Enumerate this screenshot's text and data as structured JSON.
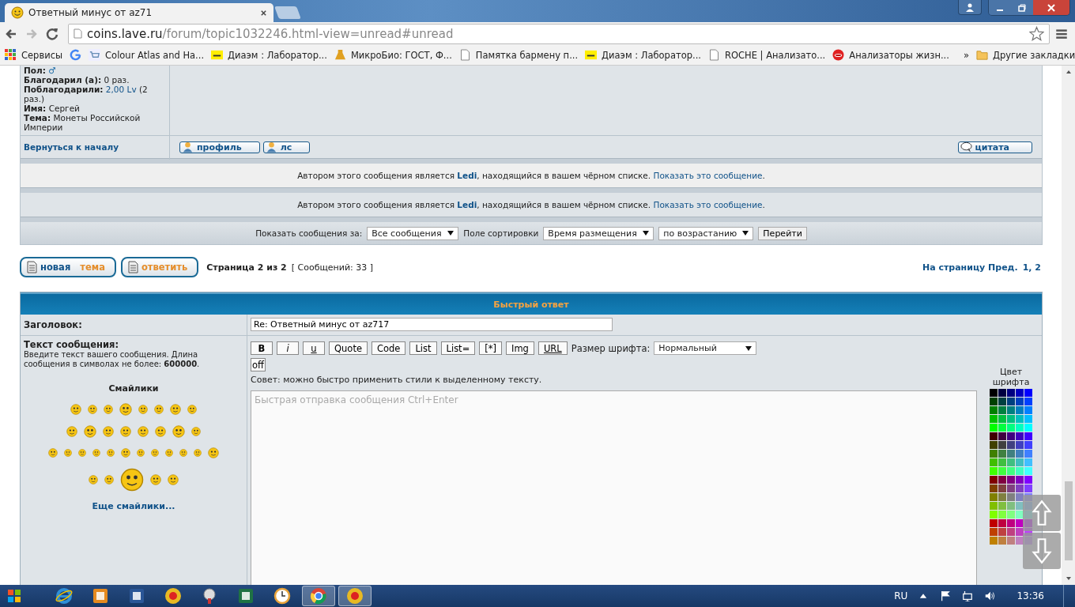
{
  "browser": {
    "tab_title": "Ответный минус от az71",
    "url_host": "coins.lave.ru",
    "url_path": "/forum/topic1032246.html-view=unread#unread",
    "bookmarks": [
      {
        "kind": "apps",
        "label": "Сервисы"
      },
      {
        "kind": "google"
      },
      {
        "kind": "cart",
        "label": "Colour Atlas and Ha..."
      },
      {
        "kind": "yellow",
        "label": "Диаэм : Лаборатор..."
      },
      {
        "kind": "micro",
        "label": "МикроБио: ГОСТ, Ф..."
      },
      {
        "kind": "page",
        "label": "Памятка бармену п..."
      },
      {
        "kind": "yellow",
        "label": "Диаэм : Лаборатор..."
      },
      {
        "kind": "page",
        "label": "ROCHE | Анализато..."
      },
      {
        "kind": "lips",
        "label": "Анализаторы жизн..."
      }
    ],
    "overflow": "»",
    "other_bookmarks": "Другие закладки"
  },
  "profile": {
    "fields": [
      {
        "label": "Пол:",
        "value": "♂",
        "kind": "icon"
      },
      {
        "label": "Благодарил (а):",
        "value": "0 раз.",
        "kind": "text"
      },
      {
        "label": "Поблагодарили:",
        "link": "2,00 Lv",
        "value": "(2 раз.)",
        "kind": "link"
      },
      {
        "label": "Имя:",
        "value": "Сергей",
        "kind": "text"
      },
      {
        "label": "Тема:",
        "value": "Монеты Российской Империи",
        "kind": "text"
      }
    ],
    "back_link": "Вернуться к началу",
    "buttons": [
      "профиль",
      "лс"
    ],
    "quote_button": "цитата"
  },
  "blocked_notices": [
    {
      "before": "Автором этого сообщения является ",
      "user": "Ledi",
      "after": ", находящийся в вашем чёрном списке. ",
      "link": "Показать это сообщение",
      "end": "."
    },
    {
      "before": "Автором этого сообщения является ",
      "user": "Ledi",
      "after": ", находящийся в вашем чёрном списке. ",
      "link": "Показать это сообщение",
      "end": "."
    }
  ],
  "sort_bar": {
    "show_label": "Показать сообщения за:",
    "show_value": "Все сообщения",
    "sort_label": "Поле сортировки",
    "sort_value": "Время размещения",
    "order_value": "по возрастанию",
    "go_button": "Перейти"
  },
  "actions": {
    "new_topic": [
      "новая",
      "тема"
    ],
    "reply": "ответить",
    "page_info": "Страница 2 из 2",
    "post_count": "[ Сообщений: 33 ]",
    "goto_label": "На страницу Пред.",
    "pages": "1, 2"
  },
  "quick_reply": {
    "title": "Быстрый ответ",
    "subject_label": "Заголовок:",
    "subject_value": "Re: Ответный минус от az717",
    "message_label": "Текст сообщения:",
    "message_hint": "Введите текст вашего сообщения. Длина сообщения в символах не более: **600000**.",
    "smilies_title": "Смайлики",
    "more_smilies": "Еще смайлики...",
    "format_buttons": [
      {
        "label": "B",
        "kind": "bold"
      },
      {
        "label": "i",
        "kind": "italic"
      },
      {
        "label": "u",
        "kind": "underline"
      },
      {
        "label": "Quote",
        "kind": "plain"
      },
      {
        "label": "Code",
        "kind": "plain"
      },
      {
        "label": "List",
        "kind": "plain"
      },
      {
        "label": "List=",
        "kind": "plain"
      },
      {
        "label": "[*]",
        "kind": "plain"
      },
      {
        "label": "Img",
        "kind": "plain"
      },
      {
        "label": "URL",
        "kind": "underline"
      }
    ],
    "font_size_label": "Размер шрифта:",
    "font_size_value": "Нормальный",
    "off_button": "off",
    "tip": "Совет: можно быстро применить стили к выделенному тексту.",
    "placeholder": "Быстрая отправка сообщения Ctrl+Enter",
    "color_label": "Цвет шрифта"
  },
  "taskbar": {
    "apps": [
      {
        "kind": "ie",
        "selected": false
      },
      {
        "kind": "media",
        "selected": false
      },
      {
        "kind": "word",
        "selected": false
      },
      {
        "kind": "onec",
        "selected": false
      },
      {
        "kind": "tool",
        "selected": false
      },
      {
        "kind": "excel",
        "selected": false
      },
      {
        "kind": "clock",
        "selected": false
      },
      {
        "kind": "chrome",
        "selected": true
      },
      {
        "kind": "onec",
        "selected": true
      }
    ],
    "language": "RU",
    "time": "13:36"
  }
}
